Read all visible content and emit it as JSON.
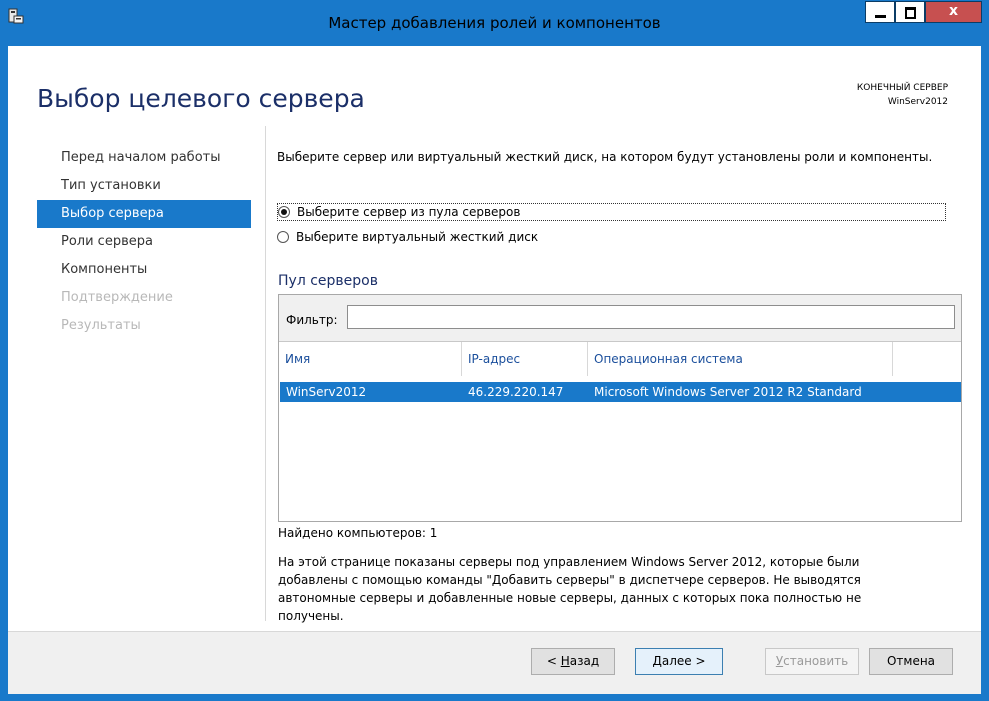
{
  "window": {
    "title": "Мастер добавления ролей и компонентов",
    "close_glyph": "x"
  },
  "page": {
    "title": "Выбор целевого сервера",
    "destination_label": "КОНЕЧНЫЙ СЕРВЕР",
    "destination_server": "WinServ2012"
  },
  "nav": {
    "items": [
      {
        "label": "Перед началом работы",
        "state": "normal"
      },
      {
        "label": "Тип установки",
        "state": "normal"
      },
      {
        "label": "Выбор сервера",
        "state": "selected"
      },
      {
        "label": "Роли сервера",
        "state": "normal"
      },
      {
        "label": "Компоненты",
        "state": "normal"
      },
      {
        "label": "Подтверждение",
        "state": "disabled"
      },
      {
        "label": "Результаты",
        "state": "disabled"
      }
    ]
  },
  "content": {
    "intro": "Выберите сервер или виртуальный жесткий диск, на котором будут установлены роли и компоненты.",
    "options": [
      {
        "label": "Выберите сервер из пула серверов",
        "checked": true
      },
      {
        "label": "Выберите виртуальный жесткий диск",
        "checked": false
      }
    ],
    "pool_title": "Пул серверов",
    "filter_label": "Фильтр:",
    "filter_value": "",
    "columns": [
      "Имя",
      "IP-адрес",
      "Операционная система"
    ],
    "rows": [
      [
        "WinServ2012",
        "46.229.220.147",
        "Microsoft Windows Server 2012 R2 Standard"
      ]
    ],
    "found_text": "Найдено компьютеров: 1",
    "description": "На этой странице показаны серверы под управлением Windows Server 2012, которые были добавлены с помощью команды \"Добавить серверы\" в диспетчере серверов. Не выводятся автономные серверы и добавленные новые серверы, данных с которых пока полностью не получены."
  },
  "buttons": {
    "back_prefix": "< ",
    "back_access": "Н",
    "back_rest": "азад",
    "next_access": "Д",
    "next_rest": "алее >",
    "install_access": "У",
    "install_rest": "становить",
    "cancel": "Отмена"
  },
  "colors": {
    "accent": "#1979ca",
    "title_text": "#1b2f68",
    "close_button": "#c75050"
  }
}
